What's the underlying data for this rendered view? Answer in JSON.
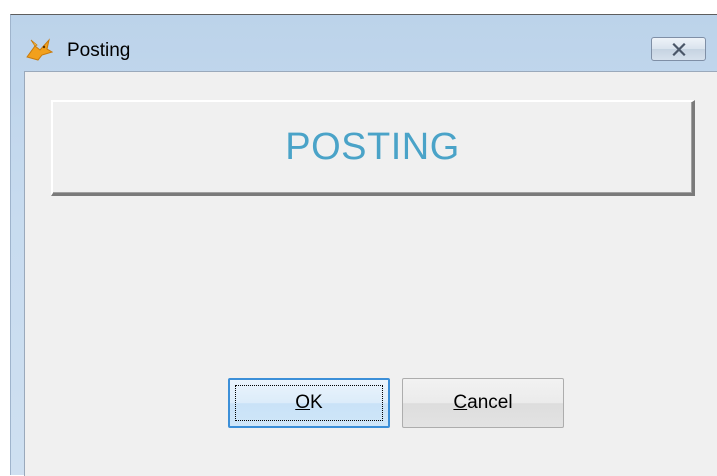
{
  "window": {
    "title": "Posting",
    "icon": "fox-icon",
    "close_icon": "close-icon"
  },
  "banner": {
    "text": "POSTING",
    "color": "#4aa3c8"
  },
  "buttons": {
    "ok": {
      "mnemonic": "O",
      "rest": "K"
    },
    "cancel": {
      "mnemonic": "C",
      "rest": "ancel"
    }
  },
  "colors": {
    "focus_border": "#3c8fd8",
    "client_bg": "#f0f0f0"
  }
}
